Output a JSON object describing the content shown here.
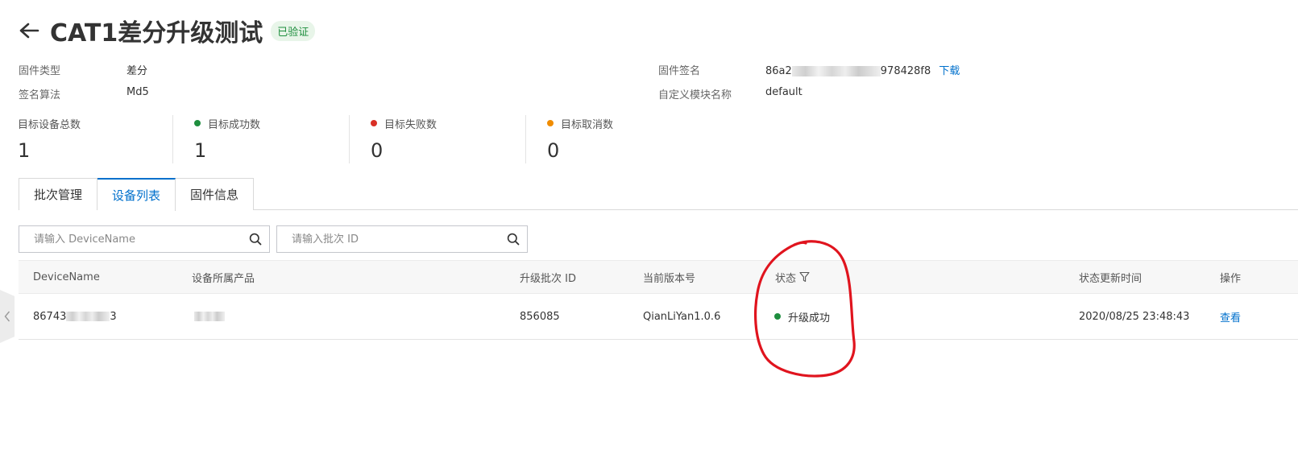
{
  "header": {
    "back_icon": "arrow-left-icon",
    "title": "CAT1差分升级测试",
    "badge": "已验证"
  },
  "info": {
    "firmware_type_label": "固件类型",
    "firmware_type_value": "差分",
    "sign_algo_label": "签名算法",
    "sign_algo_value": "Md5",
    "firmware_sign_label": "固件签名",
    "firmware_sign_prefix": "86a2",
    "firmware_sign_suffix": "978428f8",
    "download_label": "下载",
    "module_name_label": "自定义模块名称",
    "module_name_value": "default"
  },
  "stats": [
    {
      "label": "目标设备总数",
      "value": "1",
      "dot_color": ""
    },
    {
      "label": "目标成功数",
      "value": "1",
      "dot_color": "#1e8e3e"
    },
    {
      "label": "目标失败数",
      "value": "0",
      "dot_color": "#d93026"
    },
    {
      "label": "目标取消数",
      "value": "0",
      "dot_color": "#f08c00"
    }
  ],
  "tabs": [
    {
      "label": "批次管理"
    },
    {
      "label": "设备列表"
    },
    {
      "label": "固件信息"
    }
  ],
  "search": {
    "device_placeholder": "请输入 DeviceName",
    "batch_placeholder": "请输入批次 ID"
  },
  "table": {
    "headers": {
      "device_name": "DeviceName",
      "product": "设备所属产品",
      "batch_id": "升级批次 ID",
      "version": "当前版本号",
      "status": "状态",
      "updated": "状态更新时间",
      "action": "操作"
    },
    "rows": [
      {
        "device_name_prefix": "86743",
        "device_name_suffix": "3",
        "batch_id": "856085",
        "version": "QianLiYan1.0.6",
        "status": "升级成功",
        "status_color": "#1e8e3e",
        "updated": "2020/08/25 23:48:43",
        "action": "查看"
      }
    ]
  },
  "annotation_color": "#e0141e",
  "accent_color": "#0070cc"
}
